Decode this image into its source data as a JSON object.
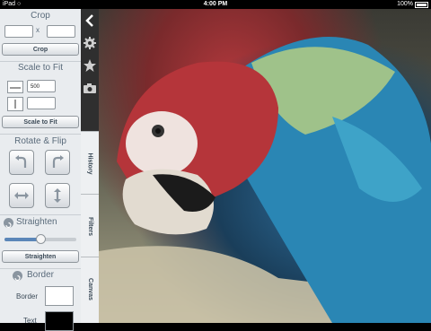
{
  "status": {
    "carrier": "iPad",
    "time": "4:00 PM",
    "battery": "100%"
  },
  "crop": {
    "title": "Crop",
    "separator": "x",
    "width": "",
    "height": "",
    "button": "Crop"
  },
  "scale": {
    "title": "Scale to Fit",
    "width_value": "500",
    "height_value": "",
    "button": "Scale to Fit"
  },
  "rotate": {
    "title": "Rotate & Flip"
  },
  "straighten": {
    "title": "Straighten",
    "slider_value": 0.5,
    "button": "Straighten"
  },
  "border": {
    "title": "Border",
    "border_label": "Border",
    "text_label": "Text"
  },
  "tabs": [
    "History",
    "Filters",
    "Canvas"
  ],
  "icons": [
    "back-chevron-icon",
    "gear-icon",
    "star-icon",
    "camera-icon"
  ]
}
